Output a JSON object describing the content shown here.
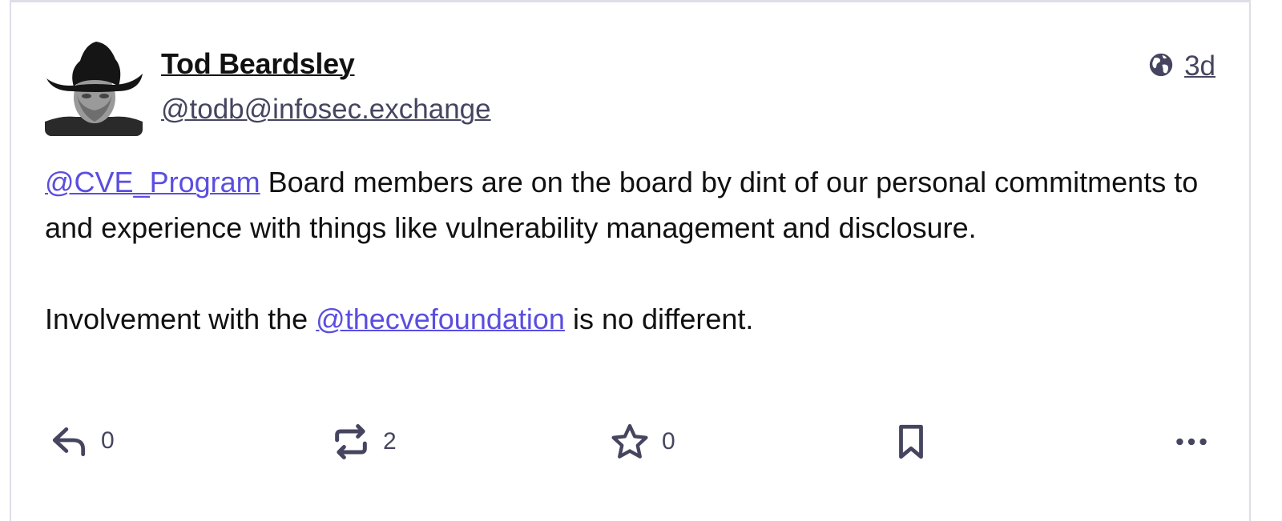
{
  "post": {
    "author_name": "Tod Beardsley",
    "author_handle": "@todb@infosec.exchange",
    "visibility_icon": "globe-icon",
    "timestamp": "3d",
    "paragraph1": {
      "mention": "@CVE_Program",
      "text": " Board members are on the board by dint of our personal commitments to and experience with things like vulnerability management and disclosure."
    },
    "paragraph2": {
      "before": "Involvement with the ",
      "mention": "@thecvefoundation",
      "after": " is no different."
    }
  },
  "actions": {
    "reply_count": "0",
    "boost_count": "2",
    "favourite_count": "0"
  },
  "colors": {
    "accent": "#5a4ee0",
    "muted": "#454560",
    "border": "#dfdde8"
  }
}
